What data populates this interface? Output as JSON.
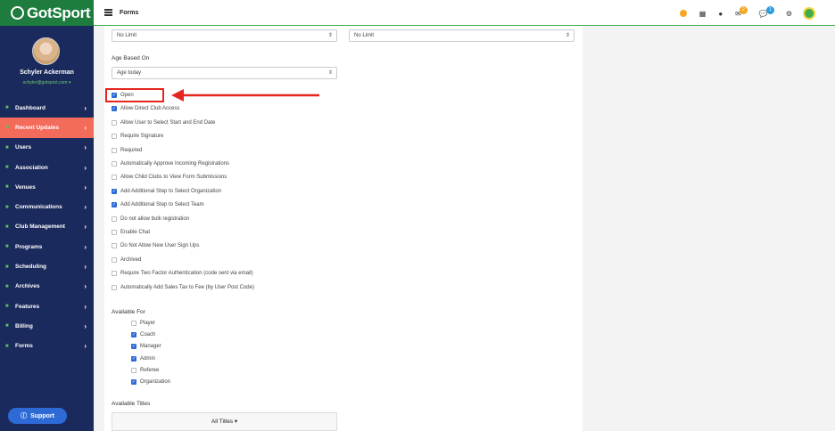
{
  "brand": {
    "name": "GotSport"
  },
  "user": {
    "name": "Schyler Ackerman",
    "email": "schyler@gotsport.com ▾"
  },
  "sidebar": {
    "items": [
      {
        "label": "Dashboard",
        "icon": "dashboard-icon"
      },
      {
        "label": "Recent Updates",
        "icon": "updates-icon",
        "active": true
      },
      {
        "label": "Users",
        "icon": "users-icon"
      },
      {
        "label": "Association",
        "icon": "association-icon"
      },
      {
        "label": "Venues",
        "icon": "venues-icon"
      },
      {
        "label": "Communications",
        "icon": "communications-icon"
      },
      {
        "label": "Club Management",
        "icon": "club-icon"
      },
      {
        "label": "Programs",
        "icon": "programs-icon"
      },
      {
        "label": "Scheduling",
        "icon": "scheduling-icon"
      },
      {
        "label": "Archives",
        "icon": "archives-icon"
      },
      {
        "label": "Features",
        "icon": "star-icon"
      },
      {
        "label": "Billing",
        "icon": "billing-icon"
      },
      {
        "label": "Forms",
        "icon": "forms-icon"
      }
    ],
    "support_label": "Support"
  },
  "header": {
    "title": "Forms",
    "mail_badge": "2",
    "chat_badge": "1"
  },
  "form": {
    "limit1": "No Limit",
    "limit2": "No Limit",
    "age_based_label": "Age Based On",
    "age_based_value": "Age today",
    "checkboxes": [
      {
        "label": "Open",
        "checked": true
      },
      {
        "label": "Allow Direct Club Access",
        "checked": true
      },
      {
        "label": "Allow User to Select Start and End Date",
        "checked": false
      },
      {
        "label": "Require Signature",
        "checked": false
      },
      {
        "label": "Required",
        "checked": false
      },
      {
        "label": "Automatically Approve Incoming Registrations",
        "checked": false
      },
      {
        "label": "Allow Child Clubs to View Form Submissions",
        "checked": false
      },
      {
        "label": "Add Additional Step to Select Organization",
        "checked": true
      },
      {
        "label": "Add Additional Step to Select Team",
        "checked": true
      },
      {
        "label": "Do not allow bulk registration",
        "checked": false
      },
      {
        "label": "Enable Chat",
        "checked": false
      },
      {
        "label": "Do Not Allow New User Sign Ups",
        "checked": false
      },
      {
        "label": "Archived",
        "checked": false
      },
      {
        "label": "Require Two Factor Authentication (code sent via email)",
        "checked": false
      },
      {
        "label": "Automatically Add Sales Tax to Fee (by User Post Code)",
        "checked": false
      }
    ],
    "available_for_label": "Available For",
    "available_for": [
      {
        "label": "Player",
        "checked": false
      },
      {
        "label": "Coach",
        "checked": true
      },
      {
        "label": "Manager",
        "checked": true
      },
      {
        "label": "Admin",
        "checked": true
      },
      {
        "label": "Referee",
        "checked": false
      },
      {
        "label": "Organization",
        "checked": true
      }
    ],
    "available_titles_label": "Available Titles",
    "titles_button": "All Titles ▾"
  }
}
